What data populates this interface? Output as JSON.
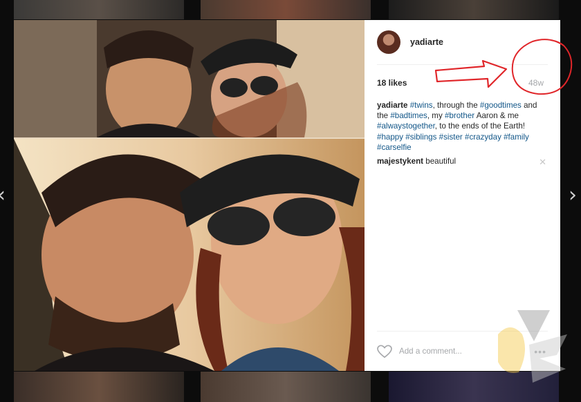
{
  "post": {
    "username": "yadiarte",
    "likes": "18 likes",
    "age": "48w",
    "caption": {
      "author": "yadiarte",
      "parts": [
        {
          "t": " "
        },
        {
          "tag": "#twins"
        },
        {
          "t": ", through the "
        },
        {
          "tag": "#goodtimes"
        },
        {
          "t": " and the "
        },
        {
          "tag": "#badtimes"
        },
        {
          "t": ", my "
        },
        {
          "tag": "#brother"
        },
        {
          "t": " Aaron & me "
        },
        {
          "tag": "#alwaystogether"
        },
        {
          "t": ", to the ends of the Earth! "
        },
        {
          "tag": "#happy"
        },
        {
          "t": " "
        },
        {
          "tag": "#siblings"
        },
        {
          "t": " "
        },
        {
          "tag": "#sister"
        },
        {
          "t": " "
        },
        {
          "tag": "#crazyday"
        },
        {
          "t": " "
        },
        {
          "tag": "#family"
        },
        {
          "t": " "
        },
        {
          "tag": "#carselfie"
        }
      ]
    },
    "comments": [
      {
        "author": "majestykent",
        "text": "beautiful"
      }
    ],
    "add_comment_placeholder": "Add a comment...",
    "more_label": "•••",
    "remove_comment_label": "✕"
  },
  "nav": {
    "prev_label": "‹",
    "next_label": "›"
  },
  "colors": {
    "hashtag": "#125688",
    "annotation": "#e0262a",
    "muted": "#a5a7aa"
  },
  "icons": [
    "heart-icon",
    "close-icon",
    "more-options-icon",
    "chevron-left-icon",
    "chevron-right-icon"
  ]
}
